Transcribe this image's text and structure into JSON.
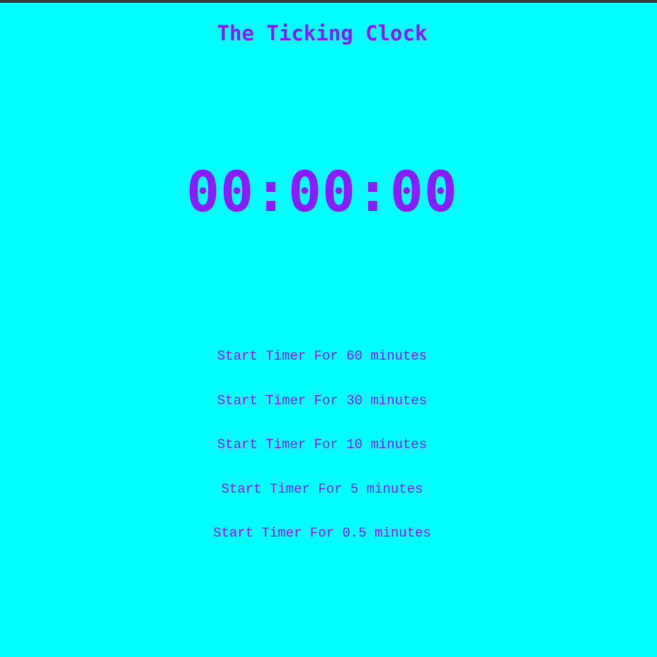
{
  "title": "The Ticking Clock",
  "clock": {
    "display": "00:00:00"
  },
  "buttons": [
    {
      "label": "Start Timer For 60 minutes"
    },
    {
      "label": "Start Timer For 30 minutes"
    },
    {
      "label": "Start Timer For 10 minutes"
    },
    {
      "label": "Start Timer For 5 minutes"
    },
    {
      "label": "Start Timer For 0.5 minutes"
    }
  ],
  "colors": {
    "background": "#00ffff",
    "accent": "#8a1dff"
  }
}
